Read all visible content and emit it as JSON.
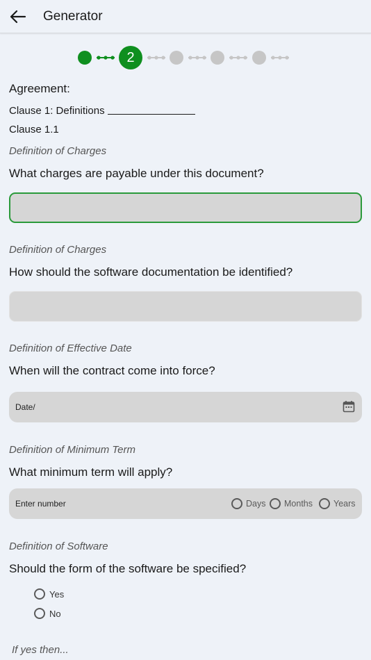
{
  "appbar": {
    "title": "Generator"
  },
  "stepper": {
    "active_step_label": "2",
    "colors": {
      "done": "#0f8f1f",
      "todo": "#c6c6c6"
    }
  },
  "document": {
    "heading": "Agreement:",
    "clause_title": "Clause 1: Definitions",
    "sub_clause": "Clause 1.1"
  },
  "questions": [
    {
      "section": "Definition of Charges",
      "question": "What charges are payable under this document?"
    },
    {
      "section": "Definition of Charges",
      "question": "How should the software documentation be identified?"
    },
    {
      "section": "Definition of Effective Date",
      "question": "When will the contract come into force?",
      "placeholder": "Date/"
    },
    {
      "section": "Definition of Minimum Term",
      "question": "What minimum term will apply?",
      "placeholder": "Enter number",
      "options": [
        "Days",
        "Months",
        "Years"
      ]
    },
    {
      "section": "Definition of Software",
      "question": "Should the form of the software be specified?",
      "options": [
        "Yes",
        "No"
      ]
    }
  ],
  "followup": "If yes then..."
}
